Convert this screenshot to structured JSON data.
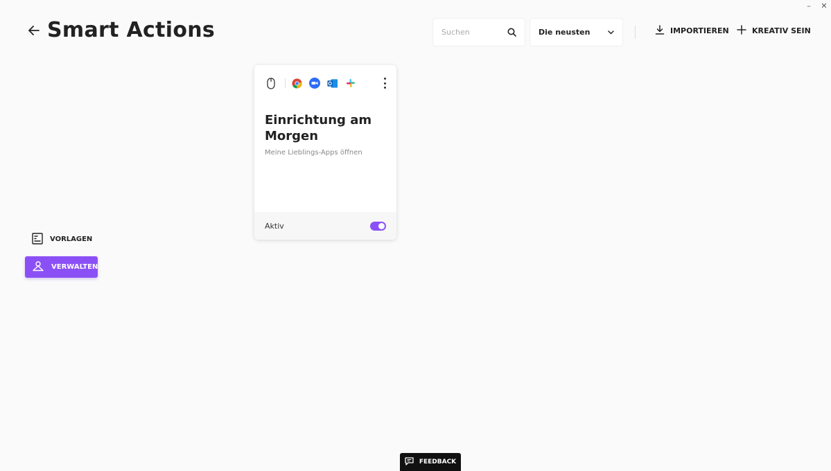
{
  "window": {
    "minimize": "–",
    "close": "✕"
  },
  "header": {
    "title": "Smart Actions",
    "search_placeholder": "Suchen",
    "search_value": "",
    "sort_selected": "Die neusten",
    "import_label": "IMPORTIEREN",
    "create_label": "KREATIV SEIN"
  },
  "sidebar": {
    "items": [
      {
        "label": "VORLAGEN",
        "icon": "templates-icon",
        "active": false
      },
      {
        "label": "VERWALTEN",
        "icon": "manage-icon",
        "active": true
      }
    ]
  },
  "cards": [
    {
      "trigger_icon": "mouse-icon",
      "app_icons": [
        "chrome-icon",
        "zoom-icon",
        "outlook-icon",
        "slack-icon"
      ],
      "title": "Einrichtung am Morgen",
      "description": "Meine Lieblings-Apps öffnen",
      "status": "Aktiv",
      "enabled": true
    }
  ],
  "feedback_label": "FEEDBACK",
  "colors": {
    "accent": "#8b50f5",
    "background": "#fafafa",
    "card": "#ffffff",
    "feedback_bg": "#111111"
  }
}
